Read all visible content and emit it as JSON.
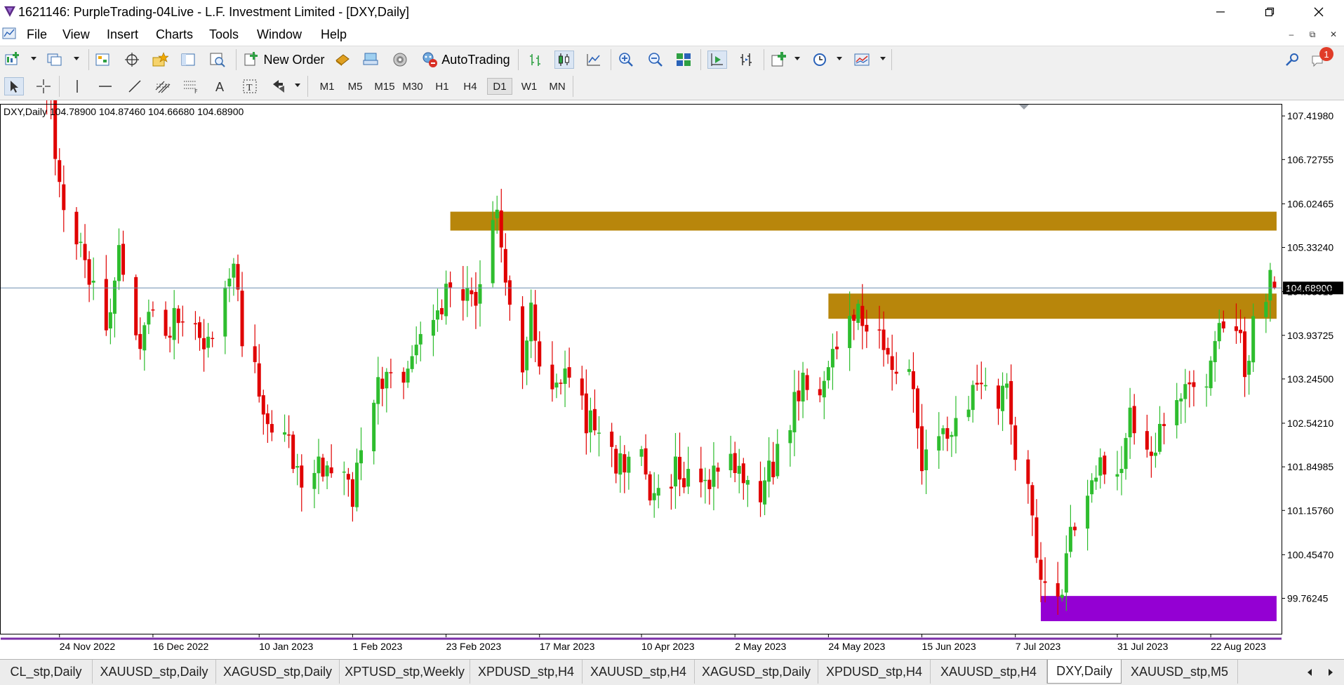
{
  "window": {
    "title": "1621146: PurpleTrading-04Live - L.F. Investment Limited - [DXY,Daily]"
  },
  "menu": [
    "File",
    "View",
    "Insert",
    "Charts",
    "Tools",
    "Window",
    "Help"
  ],
  "toolbar": {
    "new_order_label": "New Order",
    "autotrading_label": "AutoTrading",
    "notification_count": "1",
    "timeframes": [
      "M1",
      "M5",
      "M15",
      "M30",
      "H1",
      "H4",
      "D1",
      "W1",
      "MN"
    ],
    "active_timeframe": "D1"
  },
  "chart": {
    "info_label": "DXY,Daily  104.78900 104.87460 104.66680 104.68900"
  },
  "chart_data": {
    "type": "candlestick",
    "symbol": "DXY",
    "timeframe": "Daily",
    "last_bar_ohlc": [
      104.789,
      104.8746,
      104.6668,
      104.689
    ],
    "current_price": 104.689,
    "current_price_label": "104.68900",
    "ylim": [
      99.2,
      107.6
    ],
    "y_ticks": [
      "107.41980",
      "106.72755",
      "106.02465",
      "105.33240",
      "104.63015",
      "103.93725",
      "103.24500",
      "102.54210",
      "101.84985",
      "101.15760",
      "100.45470",
      "99.76245"
    ],
    "y_tick_values": [
      107.4198,
      106.72755,
      106.02465,
      105.3324,
      104.63015,
      103.93725,
      103.245,
      102.5421,
      101.84985,
      101.1576,
      100.4547,
      99.76245
    ],
    "x_ticks": [
      "24 Nov 2022",
      "16 Dec 2022",
      "10 Jan 2023",
      "1 Feb 2023",
      "23 Feb 2023",
      "17 Mar 2023",
      "10 Apr 2023",
      "2 May 2023",
      "24 May 2023",
      "15 Jun 2023",
      "7 Jul 2023",
      "31 Jul 2023",
      "22 Aug 2023"
    ],
    "x_tick_dates": [
      "2022-11-24",
      "2022-12-16",
      "2023-01-10",
      "2023-02-01",
      "2023-02-23",
      "2023-03-17",
      "2023-04-10",
      "2023-05-02",
      "2023-05-24",
      "2023-06-15",
      "2023-07-07",
      "2023-07-31",
      "2023-08-22"
    ],
    "up_color": "#2ebd2e",
    "down_color": "#e00000",
    "close_path": [
      [
        "2022-11-21",
        107.9
      ],
      [
        "2022-11-25",
        106.0
      ],
      [
        "2022-12-01",
        105.0
      ],
      [
        "2022-12-05",
        104.2
      ],
      [
        "2022-12-08",
        105.1
      ],
      [
        "2022-12-13",
        103.8
      ],
      [
        "2022-12-16",
        104.5
      ],
      [
        "2022-12-20",
        104.1
      ],
      [
        "2022-12-23",
        104.4
      ],
      [
        "2022-12-28",
        103.6
      ],
      [
        "2023-01-02",
        104.6
      ],
      [
        "2023-01-04",
        105.0
      ],
      [
        "2023-01-06",
        104.0
      ],
      [
        "2023-01-10",
        103.1
      ],
      [
        "2023-01-12",
        102.3
      ],
      [
        "2023-01-17",
        102.1
      ],
      [
        "2023-01-20",
        101.7
      ],
      [
        "2023-01-24",
        101.9
      ],
      [
        "2023-01-26",
        101.6
      ],
      [
        "2023-01-30",
        101.8
      ],
      [
        "2023-02-01",
        101.2
      ],
      [
        "2023-02-03",
        102.3
      ],
      [
        "2023-02-06",
        103.0
      ],
      [
        "2023-02-09",
        103.1
      ],
      [
        "2023-02-14",
        103.5
      ],
      [
        "2023-02-17",
        103.7
      ],
      [
        "2023-02-22",
        104.4
      ],
      [
        "2023-02-24",
        104.8
      ],
      [
        "2023-02-27",
        104.6
      ],
      [
        "2023-03-01",
        104.4
      ],
      [
        "2023-03-03",
        104.9
      ],
      [
        "2023-03-07",
        105.7
      ],
      [
        "2023-03-08",
        105.5
      ],
      [
        "2023-03-10",
        104.6
      ],
      [
        "2023-03-13",
        103.5
      ],
      [
        "2023-03-15",
        104.6
      ],
      [
        "2023-03-17",
        103.6
      ],
      [
        "2023-03-21",
        103.2
      ],
      [
        "2023-03-24",
        103.2
      ],
      [
        "2023-03-28",
        102.6
      ],
      [
        "2023-03-31",
        102.5
      ],
      [
        "2023-04-04",
        101.8
      ],
      [
        "2023-04-07",
        102.1
      ],
      [
        "2023-04-10",
        102.2
      ],
      [
        "2023-04-13",
        101.2
      ],
      [
        "2023-04-14",
        101.6
      ],
      [
        "2023-04-18",
        101.8
      ],
      [
        "2023-04-21",
        101.8
      ],
      [
        "2023-04-25",
        101.8
      ],
      [
        "2023-04-28",
        101.7
      ],
      [
        "2023-05-02",
        102.0
      ],
      [
        "2023-05-04",
        101.4
      ],
      [
        "2023-05-08",
        101.4
      ],
      [
        "2023-05-11",
        101.9
      ],
      [
        "2023-05-15",
        102.6
      ],
      [
        "2023-05-18",
        103.4
      ],
      [
        "2023-05-22",
        103.1
      ],
      [
        "2023-05-25",
        103.9
      ],
      [
        "2023-05-31",
        104.3
      ],
      [
        "2023-06-01",
        104.1
      ],
      [
        "2023-06-05",
        104.1
      ],
      [
        "2023-06-08",
        103.3
      ],
      [
        "2023-06-12",
        103.5
      ],
      [
        "2023-06-15",
        102.0
      ],
      [
        "2023-06-19",
        102.5
      ],
      [
        "2023-06-22",
        102.4
      ],
      [
        "2023-06-26",
        102.8
      ],
      [
        "2023-06-28",
        103.2
      ],
      [
        "2023-07-03",
        103.0
      ],
      [
        "2023-07-05",
        103.2
      ],
      [
        "2023-07-07",
        102.2
      ],
      [
        "2023-07-10",
        101.6
      ],
      [
        "2023-07-12",
        100.5
      ],
      [
        "2023-07-14",
        99.8
      ],
      [
        "2023-07-18",
        99.9
      ],
      [
        "2023-07-20",
        100.8
      ],
      [
        "2023-07-24",
        101.4
      ],
      [
        "2023-07-27",
        101.8
      ],
      [
        "2023-07-31",
        101.8
      ],
      [
        "2023-08-03",
        102.6
      ],
      [
        "2023-08-07",
        102.1
      ],
      [
        "2023-08-10",
        102.3
      ],
      [
        "2023-08-14",
        102.8
      ],
      [
        "2023-08-17",
        103.4
      ],
      [
        "2023-08-21",
        103.3
      ],
      [
        "2023-08-24",
        104.0
      ],
      [
        "2023-08-28",
        104.1
      ],
      [
        "2023-08-30",
        103.3
      ],
      [
        "2023-09-01",
        104.1
      ],
      [
        "2023-09-05",
        104.8
      ],
      [
        "2023-09-06",
        104.7
      ]
    ],
    "zones": [
      {
        "name": "upper-resistance-zone",
        "start": "2023-02-24",
        "end": "2023-09-06",
        "price_low": 105.6,
        "price_high": 105.9,
        "color": "#b8860b"
      },
      {
        "name": "lower-resistance-zone",
        "start": "2023-05-24",
        "end": "2023-09-06",
        "price_low": 104.2,
        "price_high": 104.6,
        "color": "#b8860b"
      },
      {
        "name": "support-zone",
        "start": "2023-07-13",
        "end": "2023-09-06",
        "price_low": 99.4,
        "price_high": 99.8,
        "color": "#9400d3"
      }
    ]
  },
  "tabs": [
    "CL_stp,Daily",
    "XAUUSD_stp,Daily",
    "XAGUSD_stp,Daily",
    "XPTUSD_stp,Weekly",
    "XPDUSD_stp,H4",
    "XAUUSD_stp,H4",
    "XAGUSD_stp,Daily",
    "XPDUSD_stp,H4",
    "XAUUSD_stp,H4",
    "DXY,Daily",
    "XAUUSD_stp,M5"
  ],
  "active_tab": "DXY,Daily"
}
